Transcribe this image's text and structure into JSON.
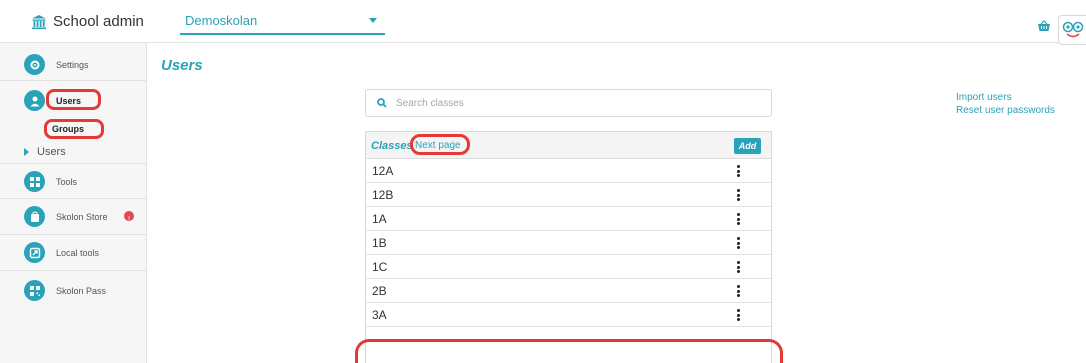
{
  "header": {
    "app_title": "School admin",
    "brand_icon": "institution-icon",
    "school_select_value": "Demoskolan",
    "basket_icon": "basket-icon",
    "logo_icon": "skolon-face-icon"
  },
  "sidebar": {
    "items": [
      {
        "label": "Settings",
        "icon": "gear-icon"
      },
      {
        "label": "Users",
        "icon": "user-icon"
      },
      {
        "label": "Tools",
        "icon": "grid-icon"
      },
      {
        "label": "Skolon Store",
        "icon": "bag-icon",
        "badge": "!"
      },
      {
        "label": "Local tools",
        "icon": "arrow-out-icon"
      },
      {
        "label": "Skolon Pass",
        "icon": "qr-icon"
      }
    ],
    "sub_items": {
      "groups": "Groups",
      "users": "Users"
    }
  },
  "main": {
    "title": "Users",
    "search_placeholder": "Search classes",
    "links": [
      "Import users",
      "Reset user passwords"
    ],
    "classes": {
      "title": "Classes",
      "next_page": "Next page",
      "add_label": "Add",
      "rows": [
        "12A",
        "12B",
        "1A",
        "1B",
        "1C",
        "2B",
        "3A"
      ]
    }
  },
  "colors": {
    "accent": "#2aa3b8",
    "highlight": "#e53935",
    "badge": "#e5484d"
  }
}
